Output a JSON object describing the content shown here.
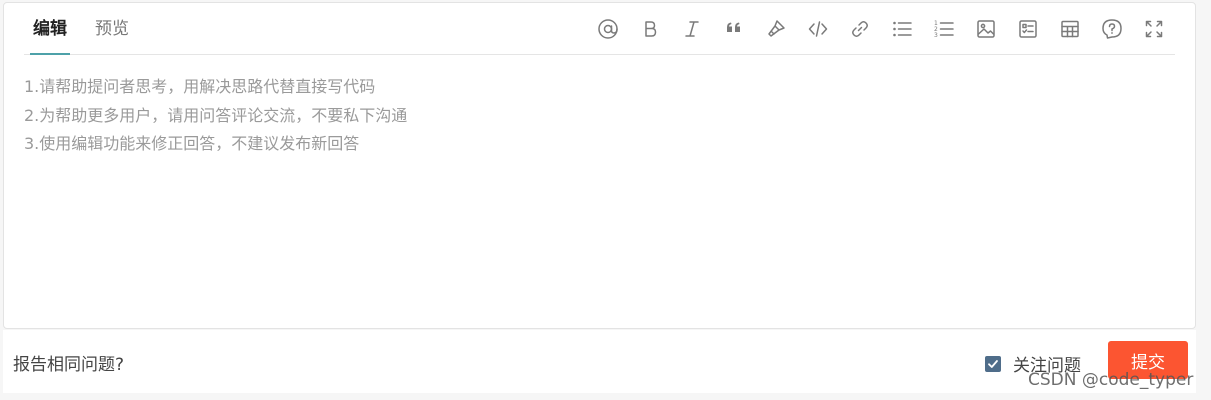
{
  "tabs": [
    {
      "label": "编辑",
      "active": true
    },
    {
      "label": "预览",
      "active": false
    }
  ],
  "toolbar": [
    {
      "icon": "at-icon",
      "label": "@"
    },
    {
      "icon": "bold-icon",
      "label": "B"
    },
    {
      "icon": "italic-icon",
      "label": "I"
    },
    {
      "icon": "quote-icon"
    },
    {
      "icon": "paint-brush-icon"
    },
    {
      "icon": "code-icon"
    },
    {
      "icon": "link-icon"
    },
    {
      "icon": "unordered-list-icon"
    },
    {
      "icon": "ordered-list-icon",
      "label_nums": [
        "1",
        "2",
        "3"
      ]
    },
    {
      "icon": "image-icon"
    },
    {
      "icon": "checklist-icon"
    },
    {
      "icon": "table-icon"
    },
    {
      "icon": "help-icon",
      "label": "?"
    },
    {
      "icon": "fullscreen-icon"
    }
  ],
  "editor": {
    "value": "",
    "placeholder_lines": [
      "1.请帮助提问者思考，用解决思路代替直接写代码",
      "2.为帮助更多用户，请用问答评论交流，不要私下沟通",
      "3.使用编辑功能来修正回答，不建议发布新回答"
    ]
  },
  "footer": {
    "report_label": "报告相同问题?",
    "follow_label": "关注问题",
    "follow_checked": true,
    "submit_label": "提交"
  },
  "watermark": "CSDN @code_typer",
  "colors": {
    "accent_tab": "#4ea1a9",
    "submit": "#fc5531",
    "checkbox": "#4f6d8a"
  }
}
